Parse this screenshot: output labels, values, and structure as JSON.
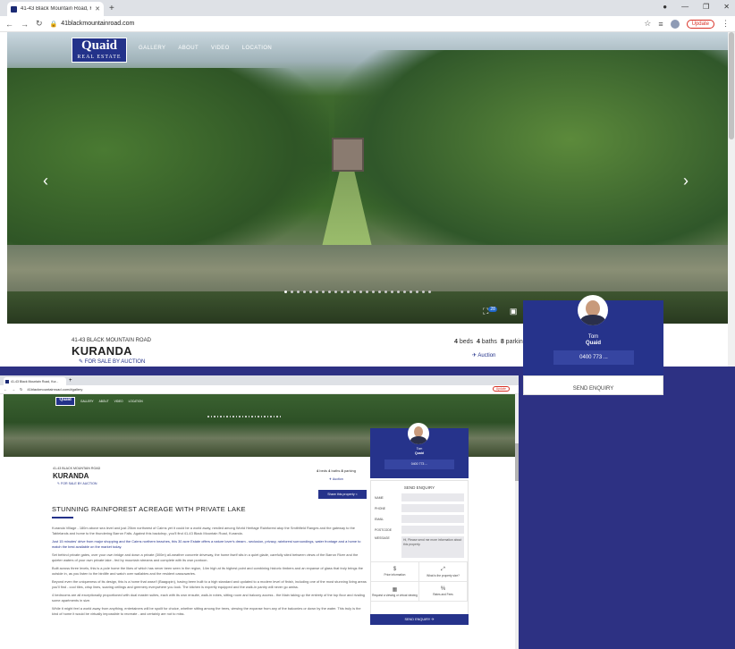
{
  "window1": {
    "tab_title": "41-43 Black Mountain Road, Kur...",
    "url": "41blackmountainroad.com",
    "update_label": "Update"
  },
  "site": {
    "logo_line1": "Quaid",
    "logo_line2": "REAL ESTATE",
    "nav": [
      "GALLERY",
      "ABOUT",
      "VIDEO",
      "LOCATION"
    ]
  },
  "hero": {
    "photo_count": "28",
    "slide_count": 24
  },
  "property": {
    "address": "41-43 BLACK MOUNTAIN ROAD",
    "suburb": "KURANDA",
    "sale_type": "FOR SALE BY AUCTION",
    "beds": "4",
    "beds_label": "beds",
    "baths": "4",
    "baths_label": "baths",
    "parking": "8",
    "parking_label": "parking",
    "auction_label": "Auction"
  },
  "agent": {
    "first_name": "Tom",
    "last_name": "Quaid",
    "phone": "0400 773 ..."
  },
  "enquiry": {
    "tab_label": "SEND ENQUIRY",
    "title": "SEND ENQUIRY",
    "fields": [
      "NAME",
      "PHONE",
      "EMAIL",
      "POSTCODE"
    ],
    "message_label": "MESSAGE",
    "message_value": "Hi, Please send me more information about this property.",
    "options": [
      "Price information",
      "What is the property size?",
      "Request a viewing or virtual viewing",
      "Rates and Fees"
    ],
    "submit_label": "SEND ENQUIRY"
  },
  "window2": {
    "tab_title": "41-43 Black Mountain Road, Kur...",
    "url": "41blackmountainroad.com/#gallery",
    "update_label": "Update"
  },
  "article": {
    "share_label": "Share this property",
    "title": "STUNNING RAINFOREST ACREAGE WITH PRIVATE LAKE",
    "paragraphs": [
      "Kuranda Village - 180m above sea level and just 25km northwest of Cairns yet it could be a world away, nestled among World Heritage Rainforest atop the Smithfield Ranges and the gateway to the Tablelands and home to the thundering Barron Falls. Against this backdrop, you'll find 41-43 Black Mountain Road, Kuranda.",
      "Just 15 minutes' drive from major shopping and the Cairns northern beaches, this 30 acre Estate offers a nature lover's dream - seclusion, privacy, rainforest surroundings, water frontage and a home to match the best available on the market today.",
      "Set behind private gates, over your own bridge and down a private (300m) all-weather concrete driveway, the home itself sits in a quiet glade, carefully sited between views of the Barron River and the quieter waters of your own private lake - fed by mountain streams and complete with its own pontoon.",
      "Built across three levels, this is a pole home the likes of which has never been seen in the region, 14m high at its highest point and combining historic timbers and an expanse of glass that truly brings the outside in, as you listen to the birdlife and watch over wallabies and the resident cassowaries.",
      "Beyond even the uniqueness of its design, this is a home that wasn't (Baagopin), having been built to a high standard and updated to a modern level of finish, including one of the most stunning living areas you'll find - cool tiles, crisp lines, soaring ceilings and greenery everywhere you look. The kitchen is expertly equipped and the walk-in pantry will never go amiss.",
      "4 bedrooms are all exceptionally proportioned with dual master suites, each with its own ensuite, walk-in robes, sitting room and balcony access - the Main taking up the entirety of the top floor and rivaling some apartments in size.",
      "While it might feel a world away from anything, entertainers will be spoilt for choice, whether sitting among the trees, viewing the expanse from any of the balconies or down by the water. This truly is the kind of home it would be virtually impossible to recreate - and certainly are not to miss."
    ]
  },
  "colors": {
    "brand": "#26338b",
    "page_bg": "#2d3183",
    "accent": "#f2c200",
    "update": "#d93025"
  }
}
